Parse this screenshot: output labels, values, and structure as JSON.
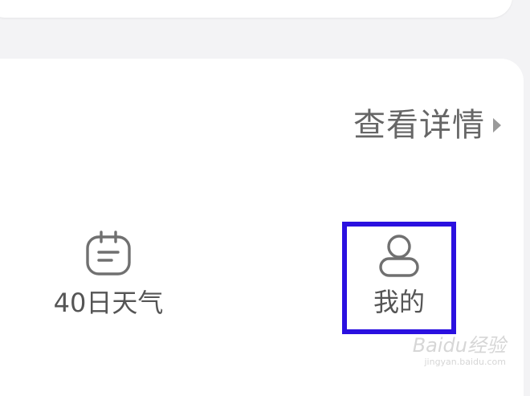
{
  "details": {
    "label": "查看详情",
    "arrow_icon": "triangle-right-icon"
  },
  "bottom_nav": {
    "items": [
      {
        "label": "40日天气",
        "icon": "calendar-list-icon"
      },
      {
        "label": "我的",
        "icon": "user-icon",
        "highlighted": true
      }
    ]
  },
  "watermark": {
    "brand": "Baidu经验",
    "url": "jingyan.baidu.com"
  },
  "colors": {
    "background": "#f3f3f5",
    "card": "#ffffff",
    "text": "#555555",
    "highlight_border": "#2a10e0"
  }
}
